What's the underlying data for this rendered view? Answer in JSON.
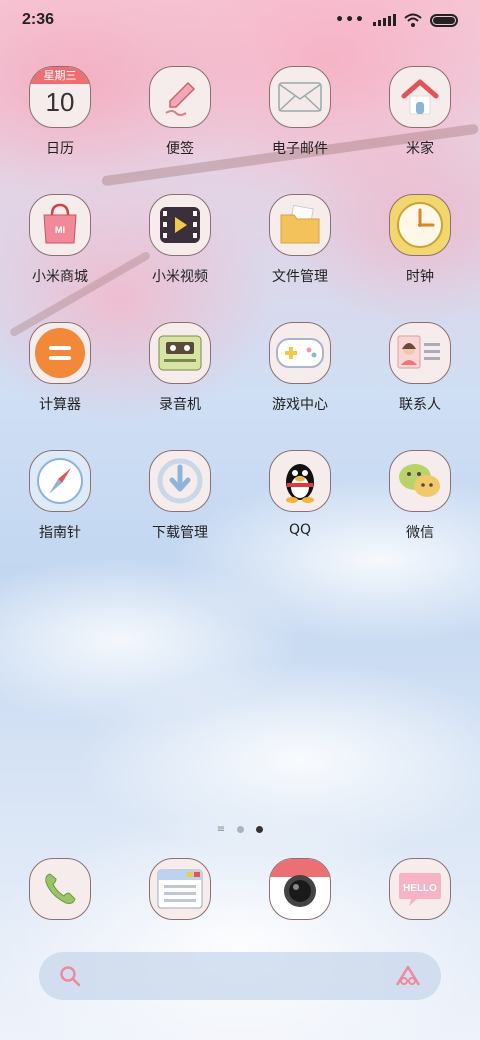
{
  "status_bar": {
    "time": "2:36",
    "more_indicator": "•••",
    "icons": [
      "signal-icon",
      "wifi-icon",
      "battery-icon"
    ],
    "battery_level": 1.0
  },
  "apps": [
    {
      "label": "日历",
      "icon": "calendar-icon",
      "weekday": "星期三",
      "day": "10"
    },
    {
      "label": "便签",
      "icon": "notes-icon"
    },
    {
      "label": "电子邮件",
      "icon": "email-icon"
    },
    {
      "label": "米家",
      "icon": "home-icon"
    },
    {
      "label": "小米商城",
      "icon": "shopping-bag-icon",
      "badge_text": "MI"
    },
    {
      "label": "小米视频",
      "icon": "video-player-icon"
    },
    {
      "label": "文件管理",
      "icon": "folder-icon"
    },
    {
      "label": "时钟",
      "icon": "clock-icon"
    },
    {
      "label": "计算器",
      "icon": "calculator-icon"
    },
    {
      "label": "录音机",
      "icon": "cassette-recorder-icon"
    },
    {
      "label": "游戏中心",
      "icon": "gamepad-icon"
    },
    {
      "label": "联系人",
      "icon": "contact-card-icon"
    },
    {
      "label": "指南针",
      "icon": "compass-icon"
    },
    {
      "label": "下载管理",
      "icon": "download-icon"
    },
    {
      "label": "QQ",
      "icon": "penguin-icon"
    },
    {
      "label": "微信",
      "icon": "chat-bubbles-icon"
    }
  ],
  "pager": {
    "pages": 2,
    "current": 2,
    "has_menu_indicator": true
  },
  "dock": [
    {
      "name": "phone",
      "icon": "phone-icon"
    },
    {
      "name": "messages",
      "icon": "browser-window-icon"
    },
    {
      "name": "camera",
      "icon": "camera-icon"
    },
    {
      "name": "hello",
      "icon": "hello-bubble-icon",
      "text": "HELLO"
    }
  ],
  "search": {
    "left_icon": "search-icon",
    "right_icon": "assistant-icon"
  },
  "colors": {
    "accent_pink": "#f08a9a",
    "accent_orange": "#f2883a",
    "icon_bg": "#f6ecec",
    "icon_border": "#8a7070"
  }
}
